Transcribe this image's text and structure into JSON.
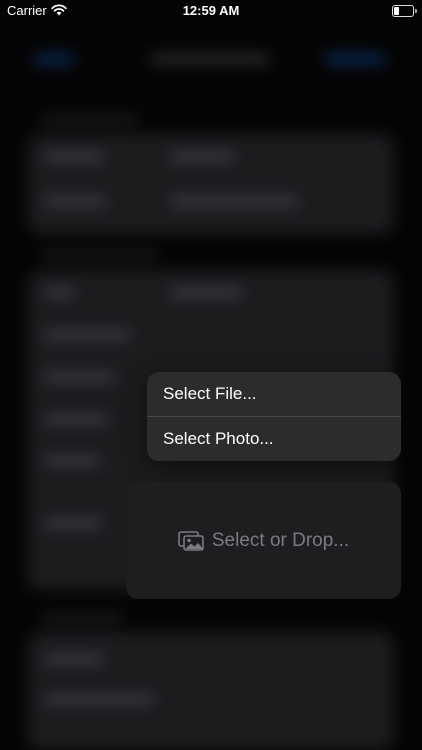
{
  "status_bar": {
    "carrier": "Carrier",
    "time": "12:59 AM"
  },
  "menu": {
    "items": [
      {
        "label": "Select File..."
      },
      {
        "label": "Select Photo..."
      }
    ]
  },
  "drop_zone": {
    "label": "Select or Drop...",
    "icon": "photos-icon"
  },
  "colors": {
    "background": "#050506",
    "menu_background": "#2c2c2e",
    "drop_zone_background": "#1e1e20",
    "drop_label": "#7b7b80"
  }
}
